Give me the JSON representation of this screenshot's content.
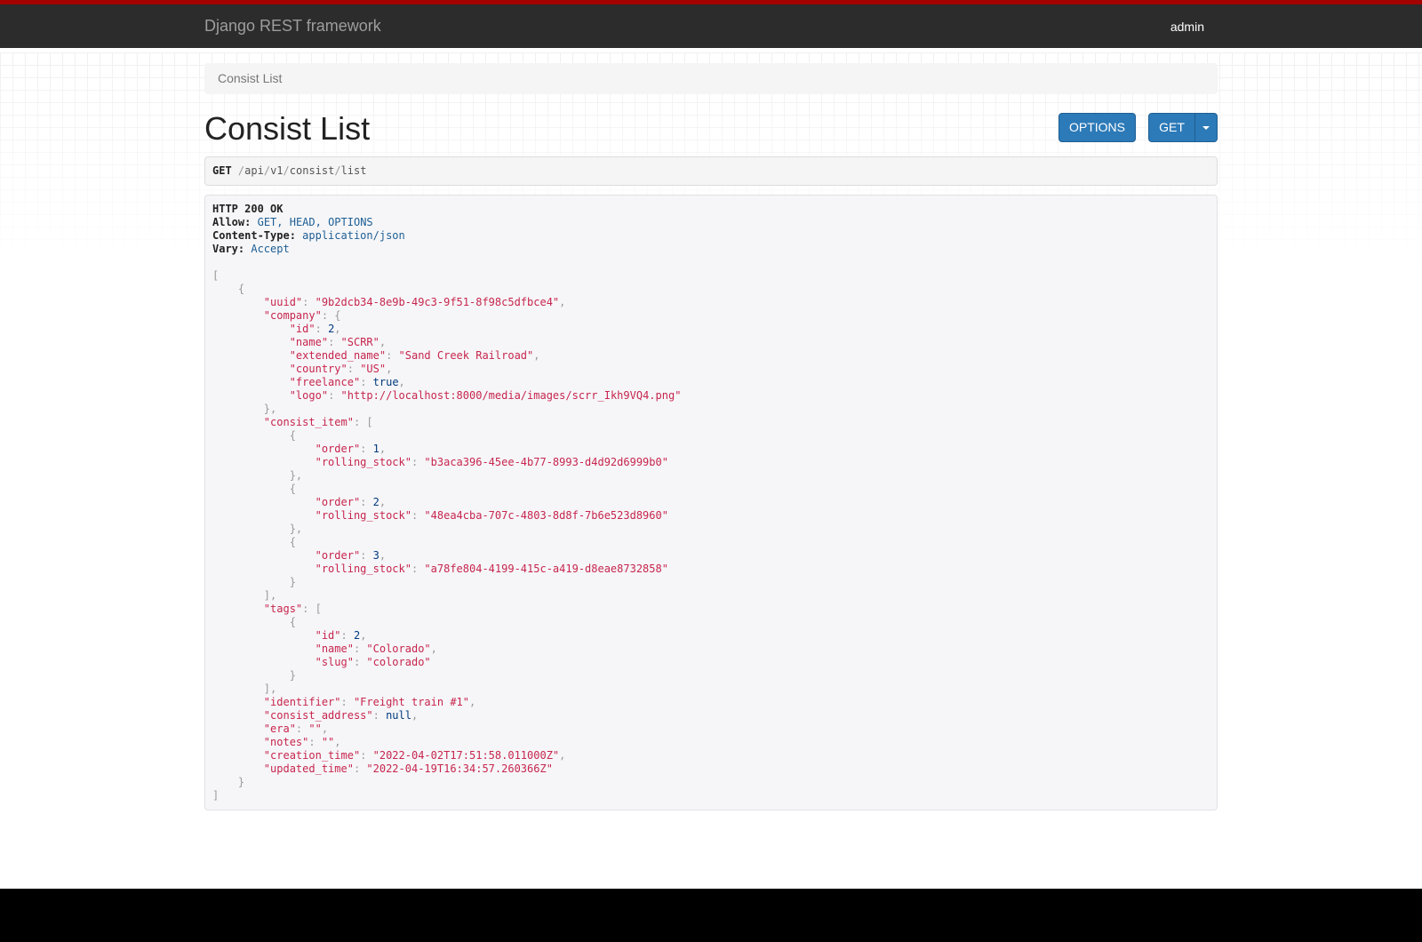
{
  "navbar": {
    "brand": "Django REST framework",
    "user": "admin"
  },
  "breadcrumb": {
    "current": "Consist List"
  },
  "page": {
    "title": "Consist List"
  },
  "buttons": {
    "options": "OPTIONS",
    "get": "GET"
  },
  "request": {
    "method": "GET",
    "path_segments": [
      "api",
      "v1",
      "consist",
      "list"
    ]
  },
  "response": {
    "status": "HTTP 200 OK",
    "headers": [
      {
        "key": "Allow:",
        "value": "GET, HEAD, OPTIONS"
      },
      {
        "key": "Content-Type:",
        "value": "application/json"
      },
      {
        "key": "Vary:",
        "value": "Accept"
      }
    ],
    "body": [
      {
        "uuid": "9b2dcb34-8e9b-49c3-9f51-8f98c5dfbce4",
        "company": {
          "id": 2,
          "name": "SCRR",
          "extended_name": "Sand Creek Railroad",
          "country": "US",
          "freelance": true,
          "logo": "http://localhost:8000/media/images/scrr_Ikh9VQ4.png"
        },
        "consist_item": [
          {
            "order": 1,
            "rolling_stock": "b3aca396-45ee-4b77-8993-d4d92d6999b0"
          },
          {
            "order": 2,
            "rolling_stock": "48ea4cba-707c-4803-8d8f-7b6e523d8960"
          },
          {
            "order": 3,
            "rolling_stock": "a78fe804-4199-415c-a419-d8eae8732858"
          }
        ],
        "tags": [
          {
            "id": 2,
            "name": "Colorado",
            "slug": "colorado"
          }
        ],
        "identifier": "Freight train #1",
        "consist_address": null,
        "era": "",
        "notes": "",
        "creation_time": "2022-04-02T17:51:58.011000Z",
        "updated_time": "2022-04-19T16:34:57.260366Z"
      }
    ]
  },
  "colors": {
    "navbar": "#2c2c2c",
    "stripe": "#a30000",
    "button": "#2c7ab8",
    "json_key": "#c7254e",
    "json_literal": "#003a7e"
  }
}
